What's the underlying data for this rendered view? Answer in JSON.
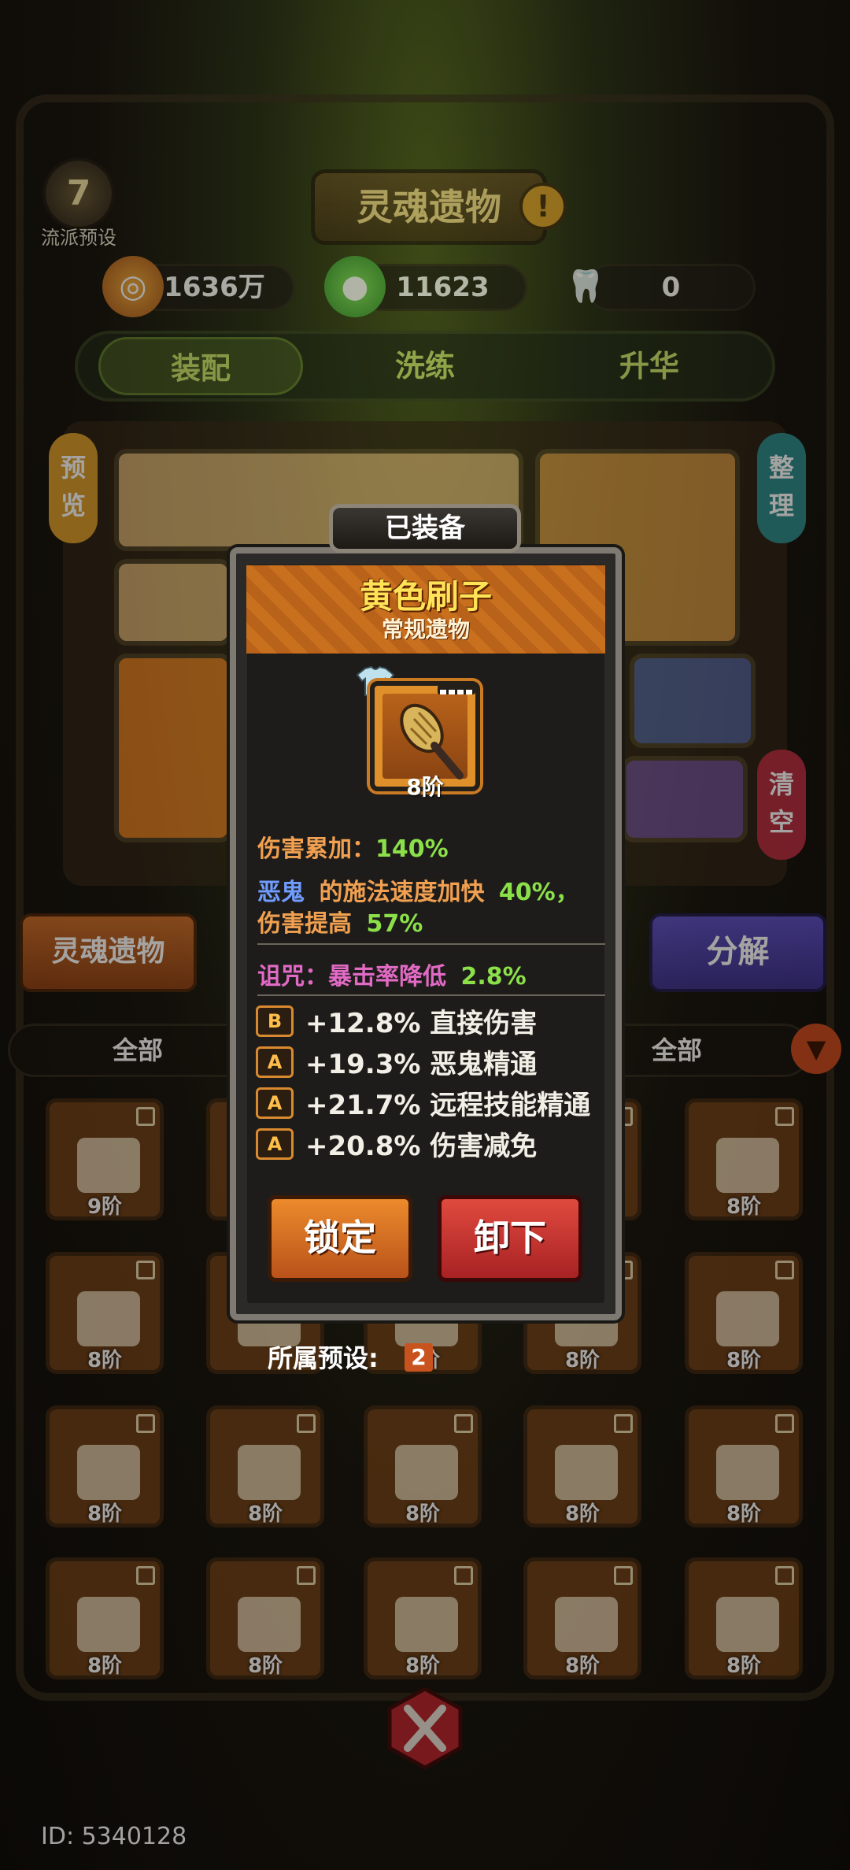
{
  "header": {
    "preset_label": "流派预设",
    "preset_badge": "7",
    "title": "灵魂遗物",
    "info_icon": "!"
  },
  "currencies": [
    {
      "icon": "coin-icon",
      "value": "1636万"
    },
    {
      "icon": "green-spirit-icon",
      "value": "11623"
    },
    {
      "icon": "tooth-icon",
      "value": "0"
    }
  ],
  "tabs": [
    {
      "label": "装配",
      "selected": true
    },
    {
      "label": "洗练",
      "selected": false
    },
    {
      "label": "升华",
      "selected": false
    }
  ],
  "side": {
    "preview": "预览",
    "organize": "整理",
    "clear": "清空"
  },
  "actions": {
    "soul_relic": "灵魂遗物",
    "decompose": "分解"
  },
  "filters": {
    "left": "全部",
    "right": "全部"
  },
  "grid_levels": [
    [
      "9阶",
      "",
      "",
      "",
      "8阶"
    ],
    [
      "8阶",
      "",
      "8阶",
      "8阶",
      "8阶"
    ],
    [
      "8阶",
      "8阶",
      "8阶",
      "8阶",
      "8阶"
    ],
    [
      "8阶",
      "8阶",
      "8阶",
      "8阶",
      "8阶"
    ]
  ],
  "player_id": "ID: 5340128",
  "popup": {
    "tab": "已装备",
    "name": "黄色刷子",
    "subtitle": "常规遗物",
    "item_level": "8阶",
    "stat1_label": "伤害累加：",
    "stat1_value": "140%",
    "stat2_target": "恶鬼",
    "stat2_text": "的施法速度加快",
    "stat2_value": "40%，",
    "stat3_text": "伤害提高",
    "stat3_value": "57%",
    "curse_label": "诅咒：暴击率降低",
    "curse_value": "2.8%",
    "affixes": [
      {
        "grade": "B",
        "text": "+12.8% 直接伤害"
      },
      {
        "grade": "A",
        "text": "+19.3% 恶鬼精通"
      },
      {
        "grade": "A",
        "text": "+21.7% 远程技能精通"
      },
      {
        "grade": "A",
        "text": "+20.8% 伤害减免"
      }
    ],
    "lock_label": "锁定",
    "unequip_label": "卸下",
    "belong_label": "所属预设:",
    "belong_value": "2"
  },
  "colors": {
    "accent_orange": "#c9701f",
    "value_green": "#8be04a",
    "target_blue": "#6f9cff",
    "curse_pink": "#e06ac4",
    "stat_orange": "#f0a050"
  }
}
